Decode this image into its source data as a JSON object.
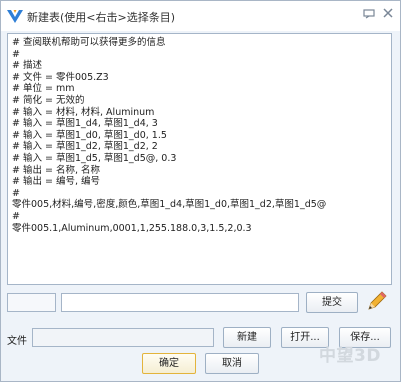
{
  "window": {
    "title": "新建表(使用<右击>选择条目)"
  },
  "editor": {
    "lines": [
      "# 查阅联机帮助可以获得更多的信息",
      "#",
      "# 描述",
      "# 文件 = 零件005.Z3",
      "# 单位 = mm",
      "# 简化 = 无效的",
      "# 输入 = 材料, 材料, Aluminum",
      "# 输入 = 草图1_d4, 草图1_d4, 3",
      "# 输入 = 草图1_d0, 草图1_d0, 1.5",
      "# 输入 = 草图1_d2, 草图1_d2, 2",
      "# 输入 = 草图1_d5, 草图1_d5@, 0.3",
      "# 输出 = 名称, 名称",
      "# 输出 = 编号, 编号",
      "#",
      "零件005,材料,编号,密度,颜色,草图1_d4,草图1_d0,草图1_d2,草图1_d5@",
      "#",
      "零件005.1,Aluminum,0001,1,255.188.0,3,1.5,2,0.3"
    ]
  },
  "entry": {
    "small_value": "",
    "main_value": "",
    "submit_label": "提交"
  },
  "file": {
    "label": "文件",
    "path_value": "",
    "new_label": "新建",
    "open_label": "打开...",
    "save_label": "保存..."
  },
  "dialog": {
    "ok_label": "确定",
    "cancel_label": "取消"
  },
  "watermark": "中望3D",
  "icons": {
    "app": "app-logo-icon",
    "pin": "pin-icon",
    "close": "close-icon",
    "pencil": "pencil-icon"
  },
  "colors": {
    "window_bg": "#eef3f9",
    "border": "#a5b5c8",
    "ok_border": "#e3b43c"
  }
}
